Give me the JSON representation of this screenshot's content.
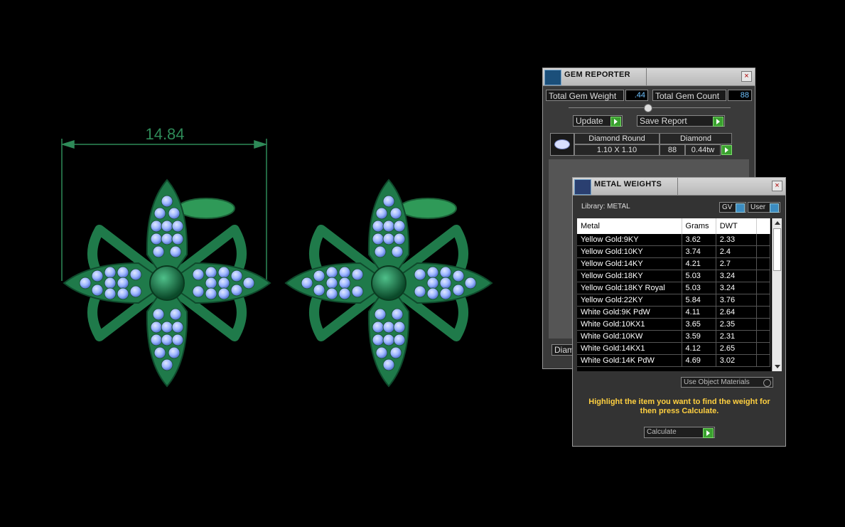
{
  "viewport": {
    "dimension_label": "14.84",
    "colors": {
      "metal": "#1f7a4a",
      "metal_dark": "#0f4a2c",
      "gem": "#9fb8ff",
      "dimension_line": "#2e8a58"
    }
  },
  "gem_reporter": {
    "title": "GEM REPORTER",
    "close": "×",
    "total_weight_label": "Total Gem Weight",
    "total_weight_value": ".44",
    "total_count_label": "Total Gem Count",
    "total_count_value": "88",
    "update_label": "Update",
    "save_report_label": "Save Report",
    "gem_row": {
      "shape": "Diamond Round",
      "size": "1.10 X 1.10",
      "material": "Diamond",
      "count": "88",
      "weight": "0.44tw"
    },
    "bottom_tab_label": "Diam"
  },
  "metal_weights": {
    "title": "METAL WEIGHTS",
    "close": "×",
    "library_label": "Library: METAL",
    "gv_label": "GV",
    "user_label": "User",
    "columns": [
      "Metal",
      "Grams",
      "DWT"
    ],
    "rows": [
      [
        "Yellow Gold:9KY",
        "3.62",
        "2.33"
      ],
      [
        "Yellow Gold:10KY",
        "3.74",
        "2.4"
      ],
      [
        "Yellow Gold:14KY",
        "4.21",
        "2.7"
      ],
      [
        "Yellow Gold:18KY",
        "5.03",
        "3.24"
      ],
      [
        "Yellow Gold:18KY Royal",
        "5.03",
        "3.24"
      ],
      [
        "Yellow Gold:22KY",
        "5.84",
        "3.76"
      ],
      [
        "White Gold:9K PdW",
        "4.11",
        "2.64"
      ],
      [
        "White Gold:10KX1",
        "3.65",
        "2.35"
      ],
      [
        "White Gold:10KW",
        "3.59",
        "2.31"
      ],
      [
        "White Gold:14KX1",
        "4.12",
        "2.65"
      ],
      [
        "White Gold:14K PdW",
        "4.69",
        "3.02"
      ]
    ],
    "use_object_materials": "Use Object Materials",
    "instruction": "Highlight the item you want to find the weight for then press Calculate.",
    "calculate_label": "Calculate",
    "accent_color": "#ffd040"
  }
}
